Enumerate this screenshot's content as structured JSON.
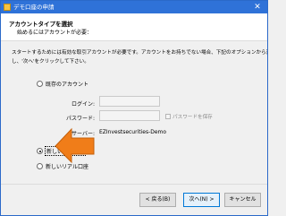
{
  "window": {
    "title": "デモ口座の申請",
    "close_glyph": "✕",
    "accent_color": "#2f72d8"
  },
  "header": {
    "title": "アカウントタイプを選択",
    "subtitle": "始めるにはアカウントが必要："
  },
  "description": [
    "スタートするためには有効な取引アカウントが必要です。アカウントをお持ちでない場合、下記のオプションから選択",
    "し、'次へ'をクリックして下さい。"
  ],
  "options": {
    "existing": {
      "label": "既存のアカウント",
      "selected": false
    },
    "login": {
      "label": "ログイン:",
      "value": ""
    },
    "password": {
      "label": "パスワード:",
      "value": "",
      "save_label": "パスワードを保存",
      "save_checked": false
    },
    "server": {
      "label": "サーバー:",
      "value": "EZInvestsecurities-Demo"
    },
    "new_demo": {
      "label": "新しいデモ口座",
      "selected": true
    },
    "new_real": {
      "label": "新しいリアル口座",
      "selected": false
    }
  },
  "annotation": {
    "arrow_color": "#f07d19",
    "arrow_direction": "left"
  },
  "buttons": {
    "back": "< 戻る(B)",
    "next": "次へ(N) >",
    "cancel": "キャンセル"
  }
}
